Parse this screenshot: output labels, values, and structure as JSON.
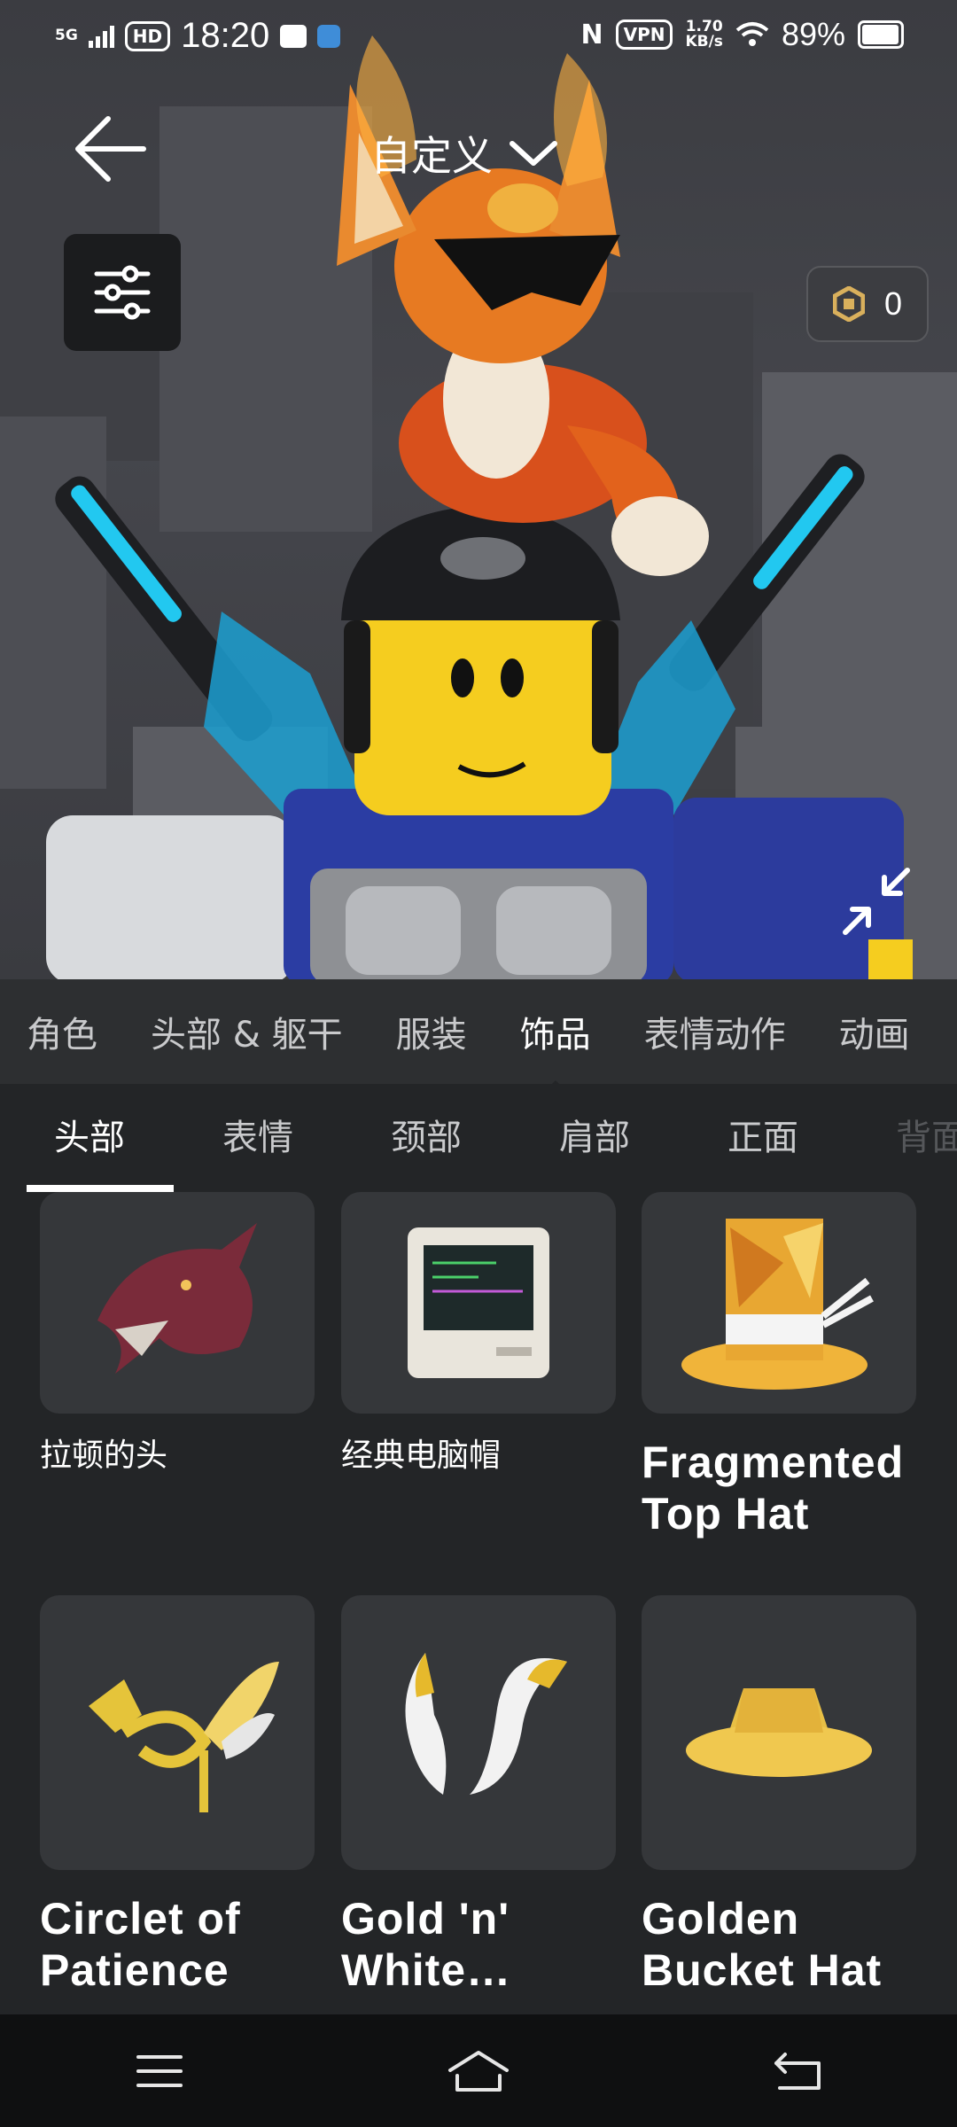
{
  "status_bar": {
    "network": "5G",
    "hd": "HD",
    "time": "18:20",
    "nfc": "N",
    "vpn": "VPN",
    "speed_value": "1.70",
    "speed_unit": "KB/s",
    "battery_text": "89%",
    "battery_level": 0.89
  },
  "header": {
    "title": "自定义"
  },
  "robux": {
    "amount": "0"
  },
  "category_tabs": [
    {
      "label": "角色"
    },
    {
      "label": "头部 & 躯干"
    },
    {
      "label": "服装"
    },
    {
      "label": "饰品",
      "active": true
    },
    {
      "label": "表情动作"
    },
    {
      "label": "动画"
    }
  ],
  "sub_tabs": [
    {
      "label": "头部",
      "active": true
    },
    {
      "label": "表情"
    },
    {
      "label": "颈部"
    },
    {
      "label": "肩部"
    },
    {
      "label": "正面"
    },
    {
      "label": "背面"
    }
  ],
  "items": [
    {
      "name": "拉顿的头",
      "icon": "dragon-head-icon"
    },
    {
      "name": "经典电脑帽",
      "icon": "computer-hat-icon"
    },
    {
      "name": "Fragmented Top Hat",
      "icon": "top-hat-icon"
    },
    {
      "name": "Circlet of Patience",
      "icon": "winged-circlet-icon"
    },
    {
      "name": "Gold 'n' White…",
      "icon": "horns-icon"
    },
    {
      "name": "Golden Bucket Hat",
      "icon": "bucket-hat-icon"
    }
  ],
  "nav": {
    "menu_icon": "menu-icon",
    "home_icon": "home-icon",
    "back_icon": "back-icon"
  },
  "colors": {
    "background": "#232527",
    "tile": "#35373a",
    "tab_bar": "#2d2f31",
    "nav_bar": "#0f1011",
    "avatar_skin": "#f5cd1f",
    "neon": "#22c8f0"
  }
}
